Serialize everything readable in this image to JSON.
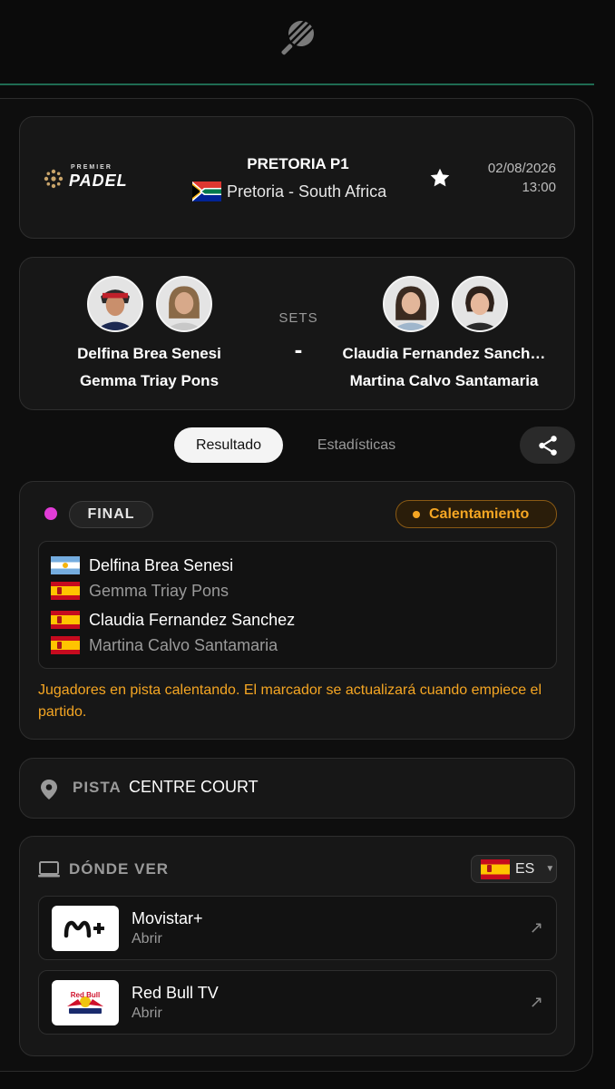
{
  "header": {
    "brand_small": "PREMIER",
    "brand_big": "PADEL",
    "tournament": "PRETORIA P1",
    "location": "Pretoria - South Africa",
    "date": "02/08/2026",
    "time": "13:00"
  },
  "match": {
    "sets_label": "SETS",
    "sets_score": "-",
    "team1": {
      "player1": "Delfina Brea Senesi",
      "player2": "Gemma Triay Pons"
    },
    "team2": {
      "player1": "Claudia Fernandez Sanch…",
      "player2": "Martina Calvo Santamaria"
    }
  },
  "tabs": {
    "result": "Resultado",
    "stats": "Estadísticas"
  },
  "status": {
    "round": "FINAL",
    "state": "Calentamiento",
    "players": [
      {
        "name": "Delfina Brea Senesi",
        "flag": "AR"
      },
      {
        "name": "Gemma Triay Pons",
        "flag": "ES"
      },
      {
        "name": "Claudia Fernandez Sanchez",
        "flag": "ES"
      },
      {
        "name": "Martina Calvo Santamaria",
        "flag": "ES"
      }
    ],
    "message": "Jugadores en pista calentando. El marcador se actualizará cuando empiece el partido."
  },
  "court": {
    "label": "PISTA",
    "value": "CENTRE COURT"
  },
  "watch": {
    "title": "DÓNDE VER",
    "country": "ES",
    "providers": [
      {
        "name": "Movistar+",
        "action": "Abrir",
        "logo_text": "M+"
      },
      {
        "name": "Red Bull TV",
        "action": "Abrir",
        "logo_text": "Red Bull TV"
      }
    ]
  },
  "colors": {
    "live_dot": "#e13cd7",
    "warm": "#f5a623",
    "accent_line": "#1f6b52"
  }
}
